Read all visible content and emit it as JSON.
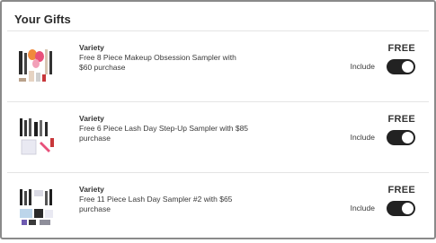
{
  "section_title": "Your Gifts",
  "gifts": [
    {
      "brand": "Variety",
      "description": "Free 8 Piece Makeup Obsession Sampler with $60 purchase",
      "price": "FREE",
      "include_label": "Include",
      "included": true
    },
    {
      "brand": "Variety",
      "description": "Free 6 Piece Lash Day Step-Up Sampler with $85 purchase",
      "price": "FREE",
      "include_label": "Include",
      "included": true
    },
    {
      "brand": "Variety",
      "description": "Free 11 Piece Lash Day Sampler #2 with $65 purchase",
      "price": "FREE",
      "include_label": "Include",
      "included": true
    }
  ],
  "colors": {
    "toggle_on": "#222222",
    "sponge_orange": "#f08a3c",
    "sponge_pink": "#e8507a",
    "lipstick_red": "#c8373a"
  }
}
